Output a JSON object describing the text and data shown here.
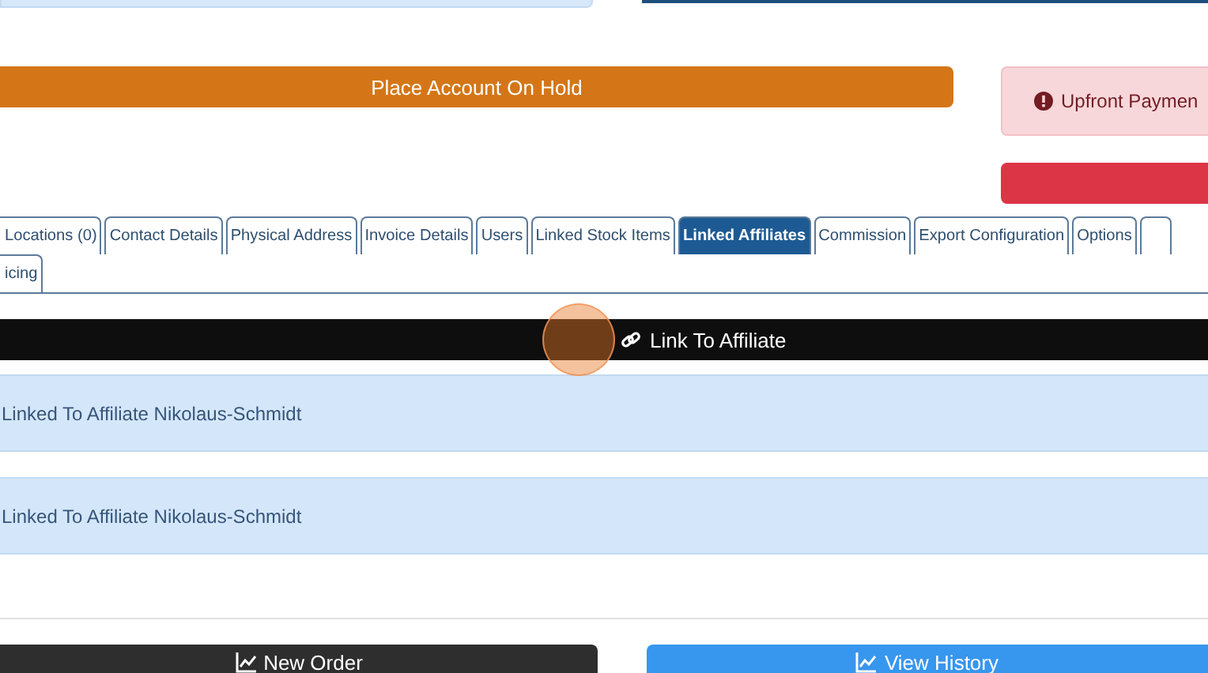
{
  "hold_button": {
    "label": "Place Account On Hold"
  },
  "alert": {
    "text": "Upfront Paymen"
  },
  "tabs": [
    {
      "label": "Locations (0)",
      "selected": false
    },
    {
      "label": "Contact Details",
      "selected": false
    },
    {
      "label": "Physical Address",
      "selected": false
    },
    {
      "label": "Invoice Details",
      "selected": false
    },
    {
      "label": "Users",
      "selected": false
    },
    {
      "label": "Linked Stock Items",
      "selected": false
    },
    {
      "label": "Linked Affiliates",
      "selected": true
    },
    {
      "label": "Commission",
      "selected": false
    },
    {
      "label": "Export Configuration",
      "selected": false
    },
    {
      "label": "Options",
      "selected": false
    },
    {
      "label": "icing",
      "selected": false
    }
  ],
  "link_button": {
    "label": "Link To Affiliate"
  },
  "affiliates": [
    {
      "text": "Linked To Affiliate Nikolaus-Schmidt"
    },
    {
      "text": "Linked To Affiliate Nikolaus-Schmidt"
    }
  ],
  "footer_buttons": [
    {
      "kind": "dark",
      "label": "New Order"
    },
    {
      "kind": "blue",
      "label": "View History"
    }
  ]
}
